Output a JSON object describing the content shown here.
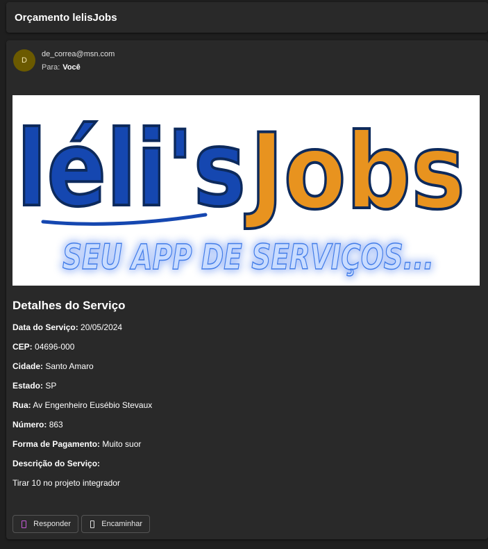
{
  "subject": "Orçamento lelisJobs",
  "header": {
    "avatar_initial": "D",
    "from": "de_correa@msn.com",
    "to_label": "Para:",
    "to_name": "Você"
  },
  "banner": {
    "brand_part1": "léli's",
    "brand_part2": "Jobs",
    "tagline": "SEU APP DE SERVIÇOS...",
    "colors": {
      "blue": "#1547b0",
      "orange": "#e8931f",
      "outline": "#0d2a5c"
    }
  },
  "details": {
    "title": "Detalhes do Serviço",
    "fields": [
      {
        "label": "Data do Serviço:",
        "value": "20/05/2024"
      },
      {
        "label": "CEP:",
        "value": "04696-000"
      },
      {
        "label": "Cidade:",
        "value": "Santo Amaro"
      },
      {
        "label": "Estado:",
        "value": "SP"
      },
      {
        "label": "Rua:",
        "value": "Av Engenheiro Eusébio Stevaux"
      },
      {
        "label": "Número:",
        "value": "863"
      },
      {
        "label": "Forma de Pagamento:",
        "value": "Muito suor"
      },
      {
        "label": "Descrição do Serviço:",
        "value": ""
      }
    ],
    "description": "Tirar 10 no projeto integrador"
  },
  "actions": {
    "reply": "Responder",
    "forward": "Encaminhar",
    "reply_icon": "reply-icon",
    "forward_icon": "forward-icon"
  }
}
